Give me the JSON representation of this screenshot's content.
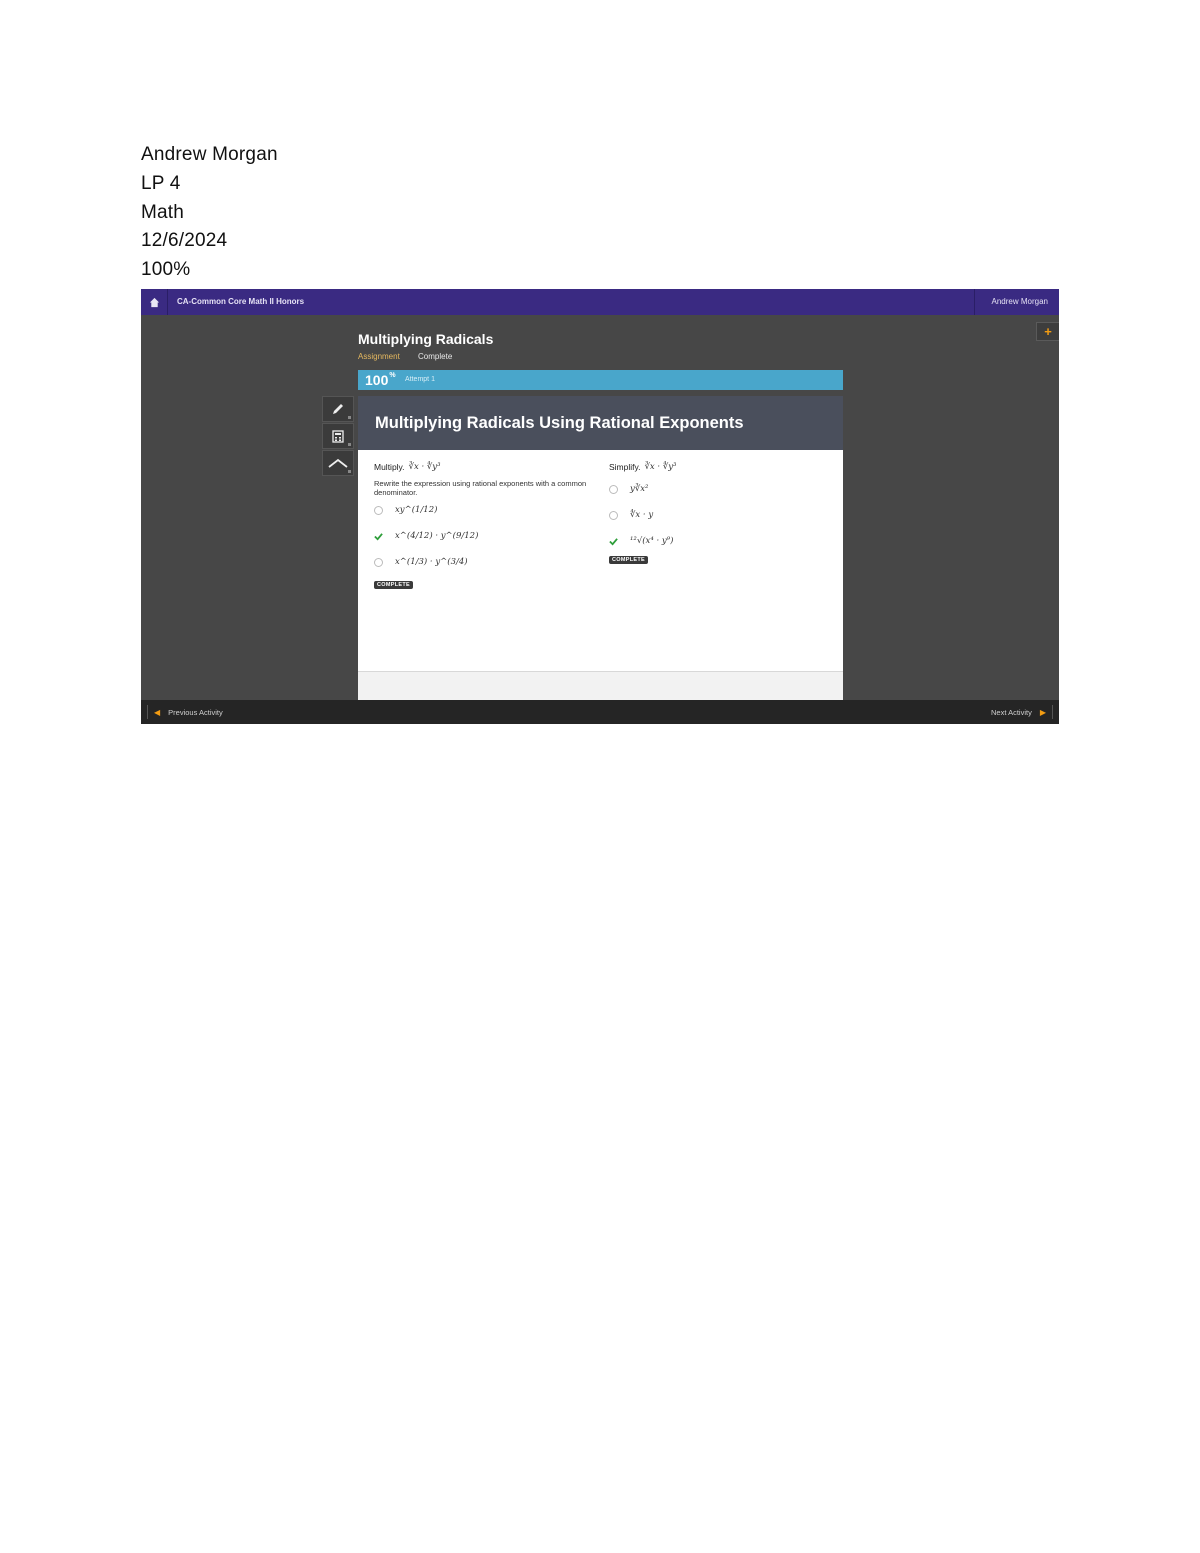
{
  "document": {
    "lines": [
      "Andrew Morgan",
      "LP 4",
      "Math",
      "12/6/2024",
      "100%"
    ]
  },
  "app": {
    "course_title": "CA-Common Core Math II Honors",
    "user_name": "Andrew Morgan",
    "lesson_title": "Multiplying Radicals",
    "tab_assignment": "Assignment",
    "tab_status": "Complete",
    "progress_value": "100",
    "progress_unit": "%",
    "progress_label": "Attempt 1",
    "progress_fraction": 1.0,
    "panel_title": "Multiplying Radicals Using Rational Exponents",
    "questions": {
      "left": {
        "prompt_label": "Multiply.",
        "prompt_math": "∛x · ∜y³",
        "instruction": "Rewrite the expression using rational exponents with a common denominator.",
        "options": [
          "xy^(1/12)",
          "x^(4/12) · y^(9/12)",
          "x^(1/3) · y^(3/4)"
        ],
        "badge": "COMPLETE"
      },
      "right": {
        "prompt_label": "Simplify.",
        "prompt_math": "∛x · ∜y³",
        "options": [
          "y∛x²",
          "∜x · y",
          "¹²√(x⁴ · y⁹)"
        ],
        "badge": "COMPLETE"
      }
    },
    "prev_label": "Previous Activity",
    "next_label": "Next Activity",
    "colors": {
      "topbar": "#3a2a82",
      "progress": "#49a6cb",
      "accent": "#f39c12",
      "check": "#2e9e3a"
    }
  }
}
